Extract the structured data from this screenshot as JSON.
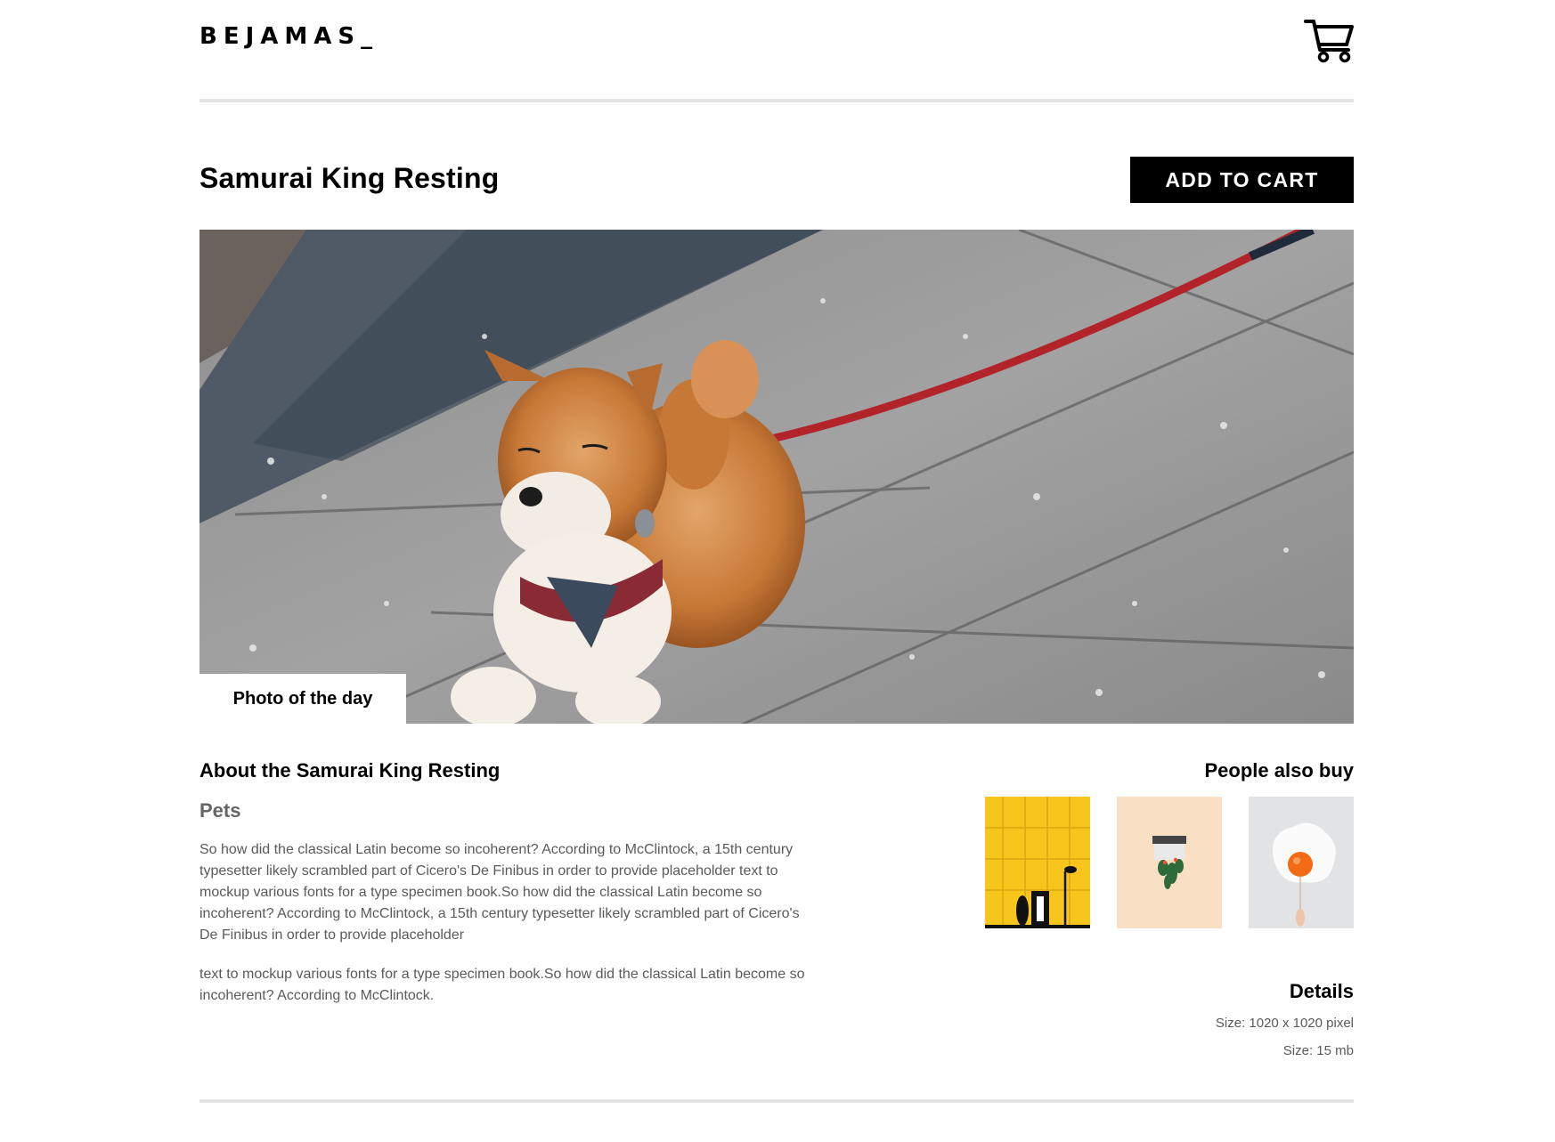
{
  "header": {
    "logo": "BEJAMAS_",
    "cart_icon": "shopping-cart-icon"
  },
  "product": {
    "title": "Samurai King Resting",
    "add_to_cart_label": "ADD TO CART",
    "hero_badge": "Photo of the day"
  },
  "about": {
    "heading": "About the Samurai King Resting",
    "category": "Pets",
    "paragraph_1": "So how did the classical Latin become so incoherent? According to McClintock, a 15th century typesetter likely scrambled part of Cicero's De Finibus in order to provide placeholder text to mockup various fonts for a type specimen book.So how did the classical Latin become so incoherent? According to McClintock, a 15th century typesetter likely scrambled part of Cicero's De Finibus in order to provide placeholder",
    "paragraph_2": "text to mockup various fonts for a type specimen book.So how did the classical Latin become so incoherent? According to McClintock."
  },
  "recommendations": {
    "heading": "People also buy"
  },
  "details": {
    "heading": "Details",
    "size_dimensions": "Size: 1020 x 1020 pixel",
    "size_file": "Size: 15 mb"
  },
  "colors": {
    "accent": "#000000",
    "rule": "#e4e4e4",
    "body_text": "#5a5a5a",
    "category_text": "#656565"
  }
}
